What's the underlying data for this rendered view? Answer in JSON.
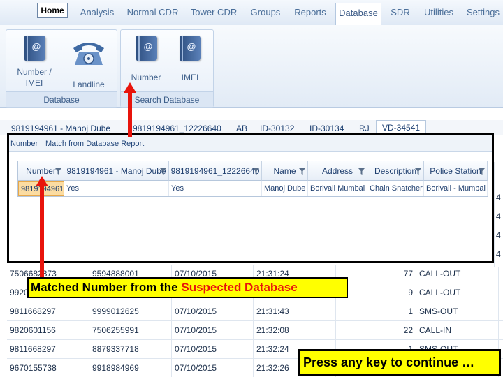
{
  "ribbon": {
    "tabs": [
      "Home",
      "Analysis",
      "Normal CDR",
      "Tower CDR",
      "Groups",
      "Reports",
      "Database",
      "SDR",
      "Utilities",
      "Settings"
    ],
    "active_tab": "Database",
    "groups": [
      {
        "label": "Database",
        "buttons": [
          {
            "label_line1": "Number /",
            "label_line2": "IMEI"
          },
          {
            "label": "Landline"
          }
        ]
      },
      {
        "label": "Search Database",
        "buttons": [
          {
            "label": "Number"
          },
          {
            "label": "IMEI"
          }
        ]
      }
    ]
  },
  "file_tabs": [
    "9819194961 - Manoj Dube",
    "9819194961_12226640",
    "AB",
    "ID-30132",
    "ID-30134",
    "RJ",
    "VD-34541"
  ],
  "dialog": {
    "tabs": [
      "Number",
      "Match from Database Report"
    ],
    "columns": [
      "Number",
      "9819194961 - Manoj Dube",
      "9819194961_12226640",
      "Name",
      "Address",
      "Description",
      "Police Station"
    ],
    "row": [
      "9819194961",
      "Yes",
      "Yes",
      "Manoj Dube",
      "Borivali Mumbai",
      "Chain Snatcher",
      "Borivali - Mumbai"
    ]
  },
  "background_table": {
    "rows": [
      [
        "7506682873",
        "9594888001",
        "07/10/2015",
        "21:31:24",
        "77",
        "CALL-OUT"
      ],
      [
        "9920",
        "",
        "",
        "",
        "9",
        "CALL-OUT"
      ],
      [
        "9811668297",
        "9999012625",
        "07/10/2015",
        "21:31:43",
        "1",
        "SMS-OUT"
      ],
      [
        "9820601156",
        "7506255991",
        "07/10/2015",
        "21:32:08",
        "22",
        "CALL-IN"
      ],
      [
        "9811668297",
        "8879337718",
        "07/10/2015",
        "21:32:24",
        "1",
        "SMS-OUT"
      ],
      [
        "9670155738",
        "9918984969",
        "07/10/2015",
        "21:32:26",
        "",
        ""
      ]
    ],
    "right_edge_char": "4"
  },
  "annotations": {
    "callout_prefix": "Matched Number from the ",
    "callout_highlight": "Suspected Database",
    "press_key": "Press any key to continue …"
  },
  "colors": {
    "accent_red": "#e8140c",
    "highlight_yellow": "#ffff00",
    "selected_cell": "#fbdca2"
  }
}
